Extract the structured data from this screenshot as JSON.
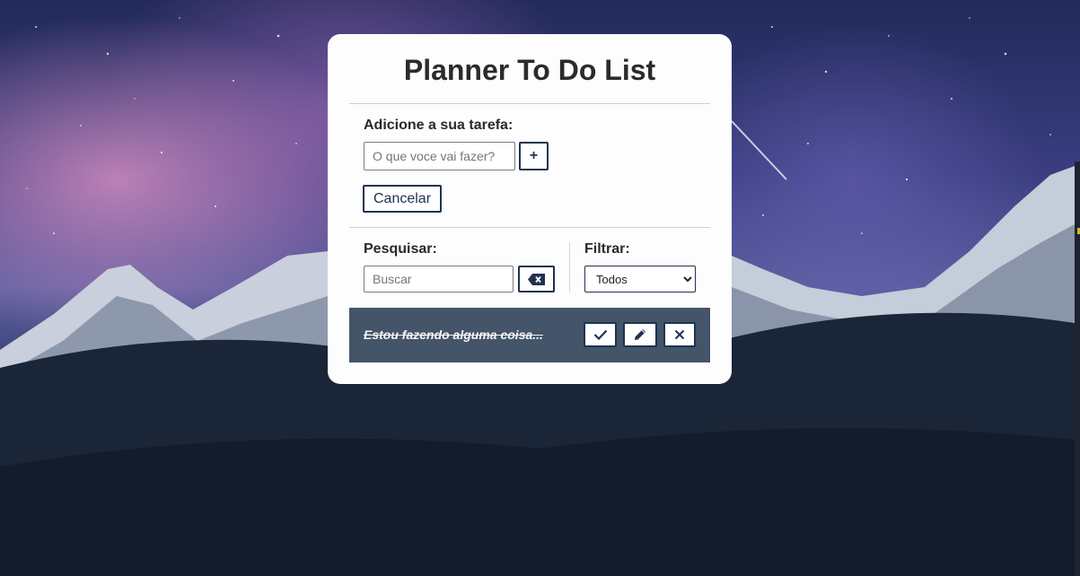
{
  "app": {
    "title": "Planner To Do List"
  },
  "add_section": {
    "label": "Adicione a sua tarefa:",
    "input_placeholder": "O que voce vai fazer?",
    "input_value": "",
    "add_button_label": "+",
    "cancel_button_label": "Cancelar"
  },
  "search_section": {
    "label": "Pesquisar:",
    "input_placeholder": "Buscar",
    "input_value": "",
    "clear_icon": "backspace-icon"
  },
  "filter_section": {
    "label": "Filtrar:",
    "selected": "Todos"
  },
  "todos": [
    {
      "text": "Estou fazendo alguma coisa...",
      "done": true,
      "actions": [
        "check-icon",
        "pencil-icon",
        "close-icon"
      ]
    }
  ],
  "colors": {
    "accent": "#1f3350",
    "todo_background": "#445469",
    "card_background": "#fdfdfd"
  }
}
